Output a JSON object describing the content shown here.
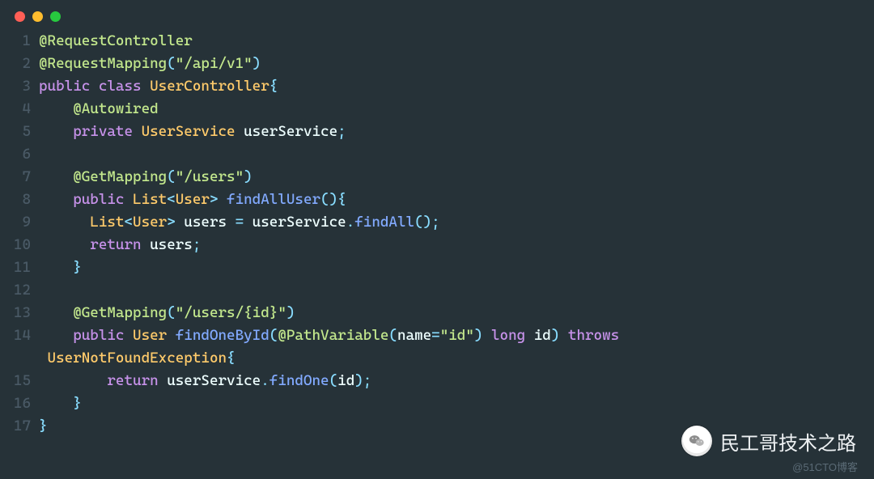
{
  "window": {
    "dots": [
      "red",
      "yellow",
      "green"
    ]
  },
  "lines": [
    {
      "n": "1",
      "html": "<span class='ann'>@RequestController</span>"
    },
    {
      "n": "2",
      "html": "<span class='ann'>@RequestMapping</span><span class='punc'>(</span><span class='str'>\"/api/v1\"</span><span class='punc'>)</span>"
    },
    {
      "n": "3",
      "html": "<span class='kw'>public</span> <span class='kw'>class</span> <span class='type'>UserController</span><span class='punc'>{</span>"
    },
    {
      "n": "4",
      "html": "    <span class='ann'>@Autowired</span>"
    },
    {
      "n": "5",
      "html": "    <span class='kw'>private</span> <span class='type'>UserService</span> <span class='ident'>userService</span><span class='punc'>;</span>"
    },
    {
      "n": "6",
      "html": ""
    },
    {
      "n": "7",
      "html": "    <span class='ann'>@GetMapping</span><span class='punc'>(</span><span class='str'>\"/users\"</span><span class='punc'>)</span>"
    },
    {
      "n": "8",
      "html": "    <span class='kw'>public</span> <span class='type'>List</span><span class='punc'>&lt;</span><span class='type'>User</span><span class='punc'>&gt;</span> <span class='method'>findAllUser</span><span class='punc'>(){</span>"
    },
    {
      "n": "9",
      "html": "      <span class='type'>List</span><span class='punc'>&lt;</span><span class='type'>User</span><span class='punc'>&gt;</span> <span class='ident'>users</span> <span class='punc'>=</span> <span class='ident'>userService</span><span class='punc'>.</span><span class='method'>findAll</span><span class='punc'>();</span>"
    },
    {
      "n": "10",
      "html": "      <span class='kw'>return</span> <span class='ident'>users</span><span class='punc'>;</span>"
    },
    {
      "n": "11",
      "html": "    <span class='punc'>}</span>"
    },
    {
      "n": "12",
      "html": ""
    },
    {
      "n": "13",
      "html": "    <span class='ann'>@GetMapping</span><span class='punc'>(</span><span class='str'>\"/users/{id}\"</span><span class='punc'>)</span>"
    },
    {
      "n": "14",
      "html": "    <span class='kw'>public</span> <span class='type'>User</span> <span class='method'>findOneById</span><span class='punc'>(</span><span class='ann'>@PathVariable</span><span class='punc'>(</span><span class='ident'>name</span><span class='punc'>=</span><span class='str'>\"id\"</span><span class='punc'>)</span> <span class='kw'>long</span> <span class='ident'>id</span><span class='punc'>)</span> <span class='kw'>throws</span> "
    },
    {
      "n": "",
      "html": " <span class='type'>UserNotFoundException</span><span class='punc'>{</span>"
    },
    {
      "n": "15",
      "html": "        <span class='kw'>return</span> <span class='ident'>userService</span><span class='punc'>.</span><span class='method'>findOne</span><span class='punc'>(</span><span class='ident'>id</span><span class='punc'>);</span>"
    },
    {
      "n": "16",
      "html": "    <span class='punc'>}</span>"
    },
    {
      "n": "17",
      "html": "<span class='punc'>}</span>"
    }
  ],
  "watermark": {
    "text": "民工哥技术之路",
    "credit": "@51CTO博客"
  }
}
